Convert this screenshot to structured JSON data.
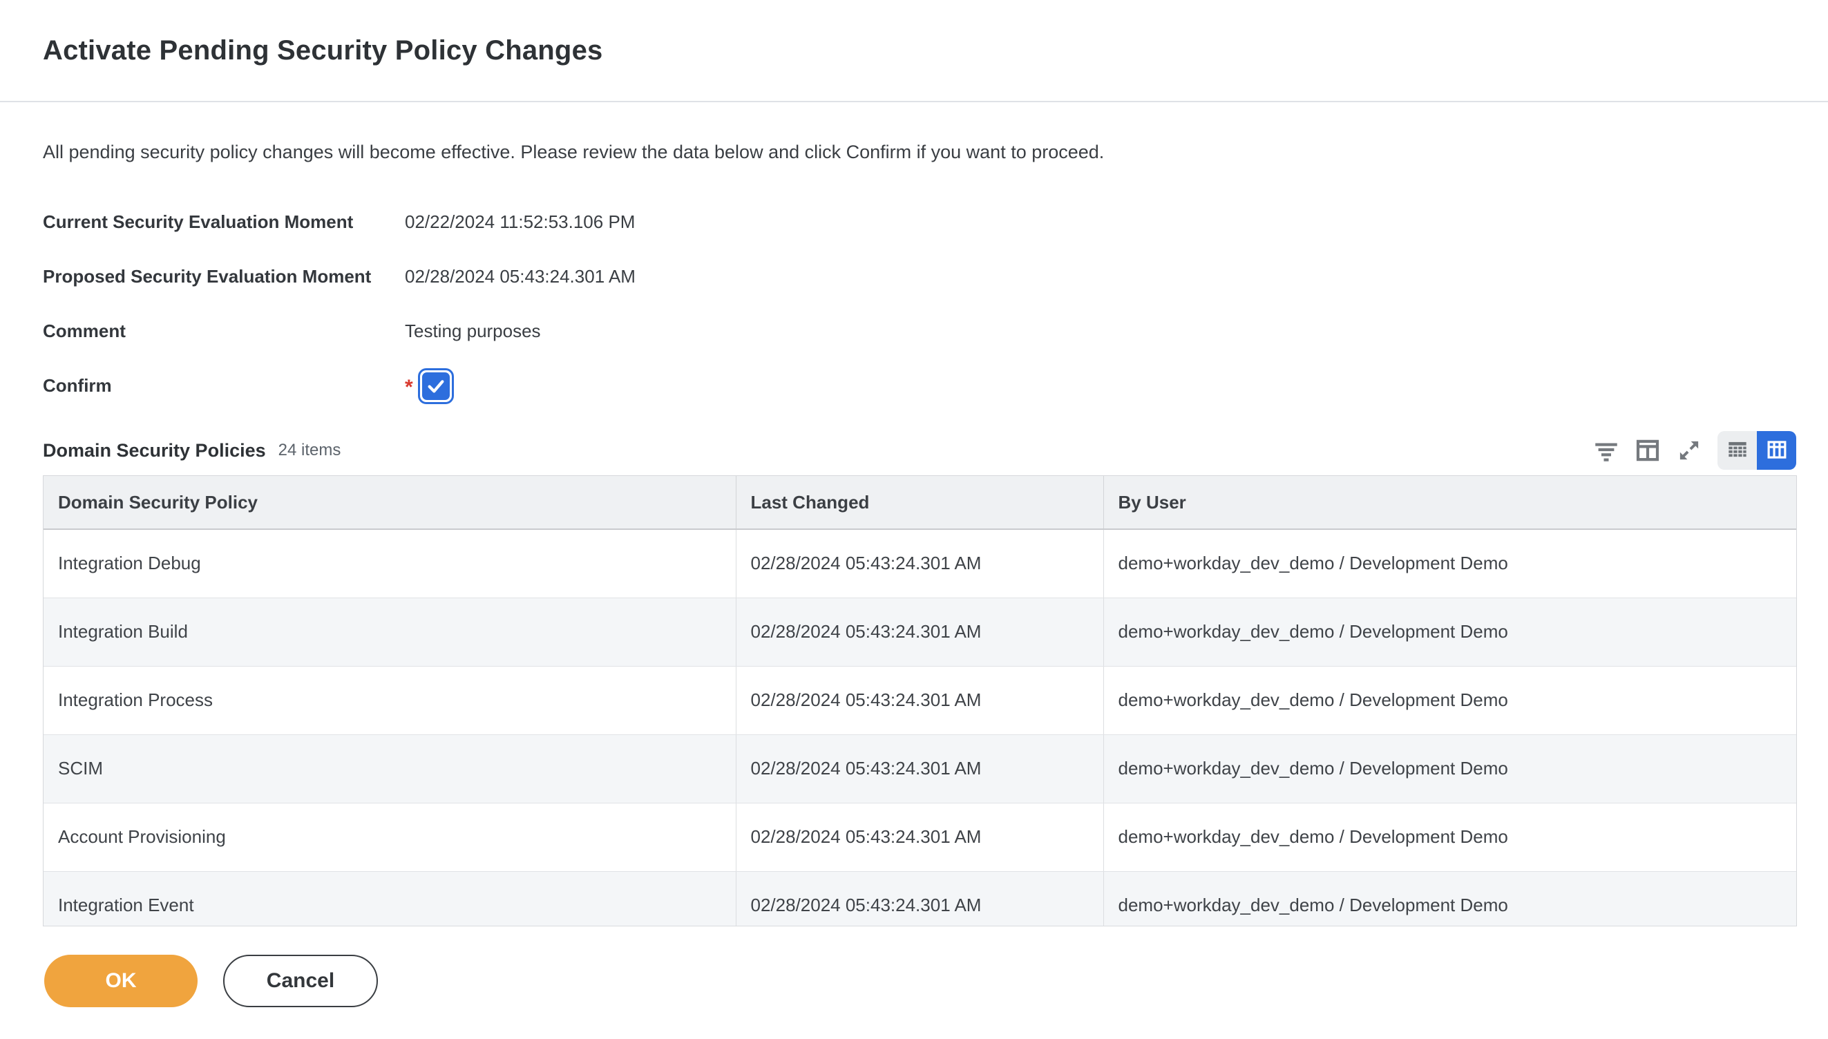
{
  "page": {
    "title": "Activate Pending Security Policy Changes",
    "description": "All pending security policy changes will become effective. Please review the data below and click Confirm if you want to proceed."
  },
  "fields": [
    {
      "label": "Current Security Evaluation Moment",
      "value": "02/22/2024 11:52:53.106 PM"
    },
    {
      "label": "Proposed Security Evaluation Moment",
      "value": "02/28/2024 05:43:24.301 AM"
    },
    {
      "label": "Comment",
      "value": "Testing purposes"
    }
  ],
  "confirm": {
    "label": "Confirm",
    "required_marker": "*",
    "checked": true
  },
  "grid": {
    "title": "Domain Security Policies",
    "count_label": "24 items",
    "toolbar_icons": [
      "filter-icon",
      "column-panel-icon",
      "expand-icon",
      "table-view-icon",
      "grid-view-icon"
    ],
    "columns": [
      "Domain Security Policy",
      "Last Changed",
      "By User"
    ],
    "rows": [
      {
        "policy": "Integration Debug",
        "last_changed": "02/28/2024 05:43:24.301 AM",
        "by_user": "demo+workday_dev_demo / Development Demo"
      },
      {
        "policy": "Integration Build",
        "last_changed": "02/28/2024 05:43:24.301 AM",
        "by_user": "demo+workday_dev_demo / Development Demo"
      },
      {
        "policy": "Integration Process",
        "last_changed": "02/28/2024 05:43:24.301 AM",
        "by_user": "demo+workday_dev_demo / Development Demo"
      },
      {
        "policy": "SCIM",
        "last_changed": "02/28/2024 05:43:24.301 AM",
        "by_user": "demo+workday_dev_demo / Development Demo"
      },
      {
        "policy": "Account Provisioning",
        "last_changed": "02/28/2024 05:43:24.301 AM",
        "by_user": "demo+workday_dev_demo / Development Demo"
      },
      {
        "policy": "Integration Event",
        "last_changed": "02/28/2024 05:43:24.301 AM",
        "by_user": "demo+workday_dev_demo / Development Demo"
      }
    ]
  },
  "footer": {
    "ok_label": "OK",
    "cancel_label": "Cancel"
  },
  "colors": {
    "accent_blue": "#2d6edd",
    "ok_orange": "#f0a43e",
    "required_red": "#d93a2f",
    "table_header_bg": "#eff1f3",
    "row_alt_bg": "#f4f6f8"
  }
}
